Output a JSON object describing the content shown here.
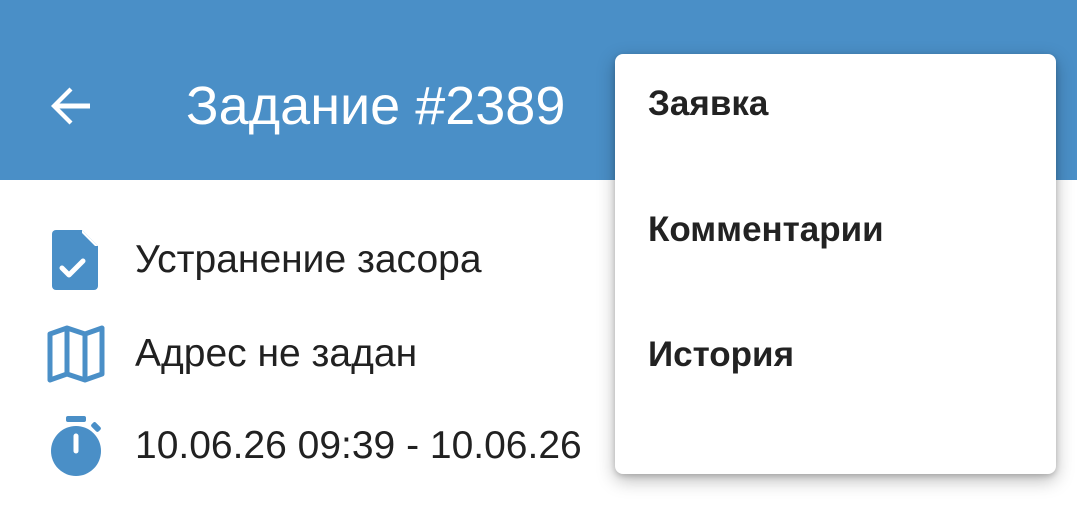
{
  "header": {
    "title": "Задание #2389",
    "background_color": "#4a8fc7",
    "back_icon": "arrow-left-icon"
  },
  "details": {
    "work_type": "Устранение засора",
    "address": "Адрес не задан",
    "time_range": "10.06.26 09:39 - 10.06.26",
    "icon_color": "#4a8fc7",
    "icons": [
      "document-check-icon",
      "map-icon",
      "stopwatch-icon"
    ]
  },
  "menu": {
    "items": [
      {
        "label": "Заявка"
      },
      {
        "label": "Комментарии"
      },
      {
        "label": "История"
      }
    ]
  }
}
